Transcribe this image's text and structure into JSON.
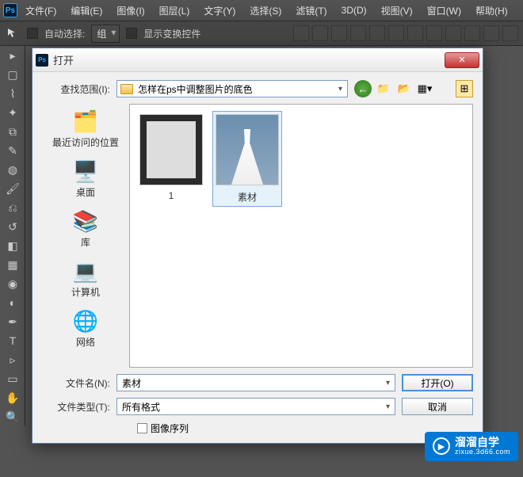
{
  "app": {
    "logo": "Ps"
  },
  "menu": [
    "文件(F)",
    "编辑(E)",
    "图像(I)",
    "图层(L)",
    "文字(Y)",
    "选择(S)",
    "滤镜(T)",
    "3D(D)",
    "视图(V)",
    "窗口(W)",
    "帮助(H)"
  ],
  "options": {
    "auto_select": "自动选择:",
    "group": "组",
    "show_transform": "显示变换控件"
  },
  "dialog": {
    "title": "打开",
    "lookin_label": "查找范围(I):",
    "lookin_value": "怎样在ps中调整图片的底色",
    "places": {
      "recent": "最近访问的位置",
      "desktop": "桌面",
      "library": "库",
      "computer": "计算机",
      "network": "网络"
    },
    "files": [
      {
        "name": "1"
      },
      {
        "name": "素材"
      }
    ],
    "filename_label": "文件名(N):",
    "filename_value": "素材",
    "filetype_label": "文件类型(T):",
    "filetype_value": "所有格式",
    "open_btn": "打开(O)",
    "cancel_btn": "取消",
    "image_seq": "图像序列"
  },
  "watermark": {
    "main": "溜溜自学",
    "sub": "zixue.3d66.com"
  }
}
